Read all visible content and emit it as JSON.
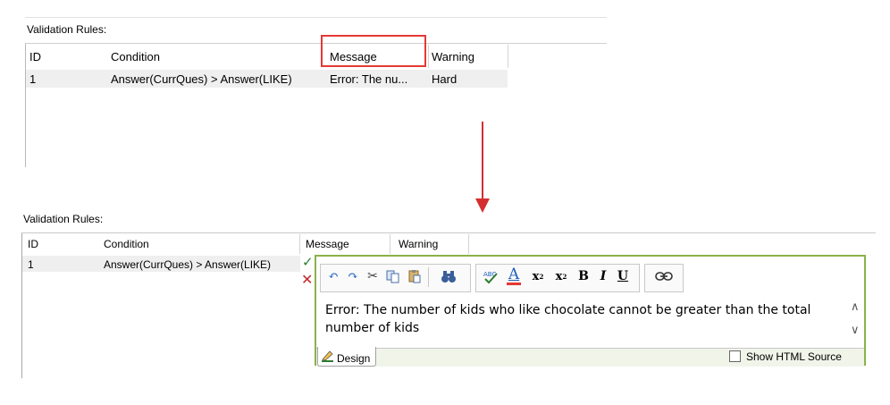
{
  "top_panel": {
    "section_label": "Validation Rules:",
    "columns": [
      "ID",
      "Condition",
      "Message",
      "Warning"
    ],
    "rows": [
      {
        "id": "1",
        "condition": "Answer(CurrQues) > Answer(LIKE)",
        "message": "Error: The nu...",
        "warning": "Hard"
      }
    ]
  },
  "bottom_panel": {
    "section_label": "Validation Rules:",
    "columns": [
      "ID",
      "Condition",
      "Message",
      "Warning"
    ],
    "rows": [
      {
        "id": "1",
        "condition": "Answer(CurrQues) > Answer(LIKE)"
      }
    ],
    "editor": {
      "content": "Error: The number of kids who like chocolate cannot be greater than the total number of kids",
      "design_tab": "Design",
      "show_html_label": "Show HTML Source",
      "toolbar": {
        "bold": "B",
        "italic": "I",
        "underline": "U",
        "font_color": "A",
        "subscript": "x",
        "superscript": "x"
      }
    }
  },
  "colors": {
    "highlight": "#e53935",
    "arrow": "#d32f2f",
    "editor_border": "#8bb24a",
    "accept": "#2e7d32",
    "cancel": "#c62828"
  }
}
